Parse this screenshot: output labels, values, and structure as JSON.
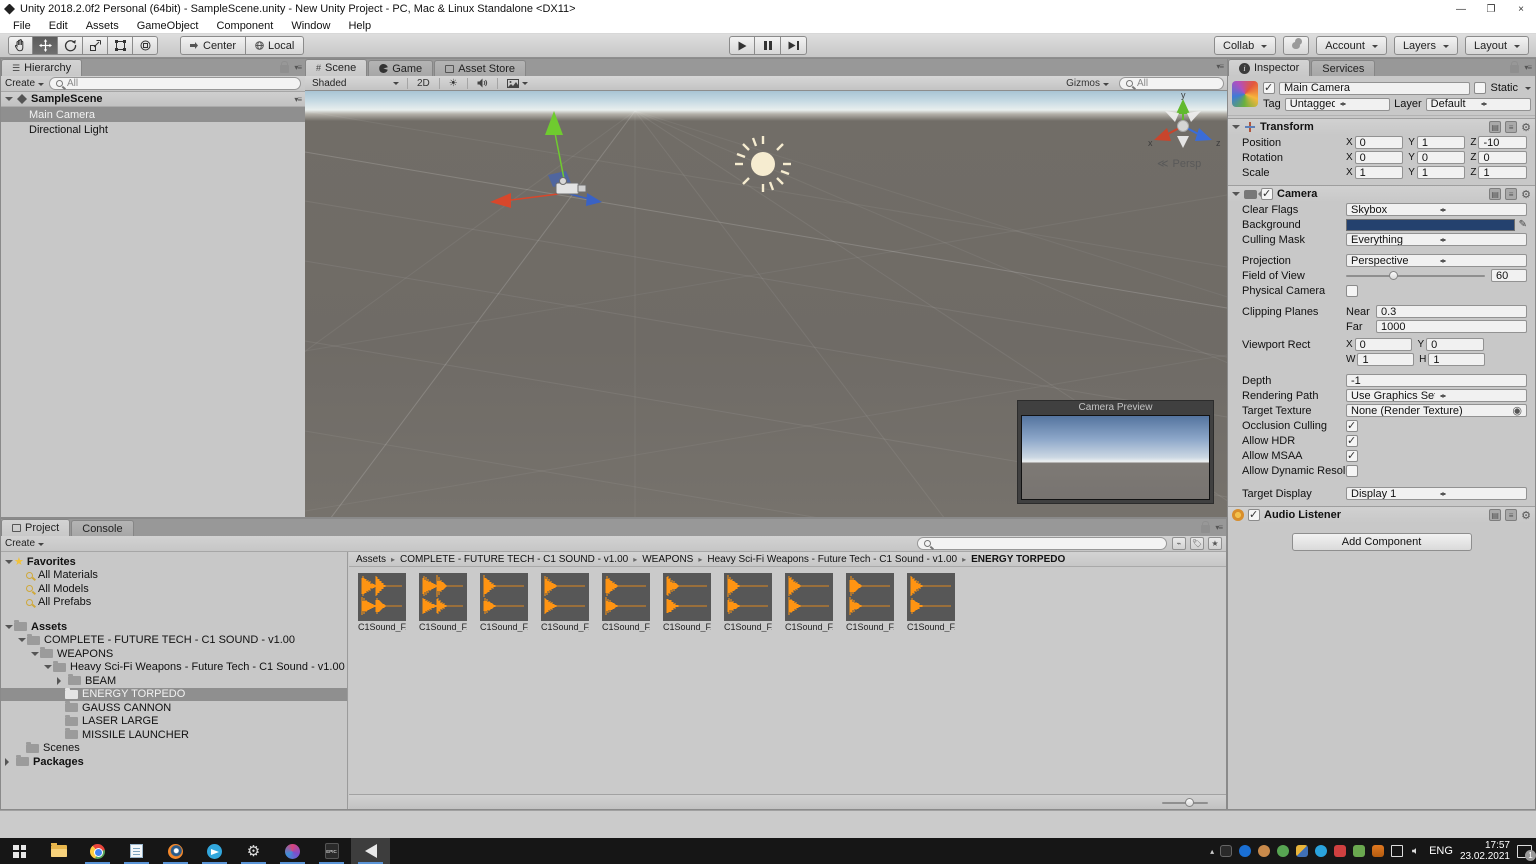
{
  "window": {
    "title": "Unity 2018.2.0f2 Personal (64bit) - SampleScene.unity - New Unity Project - PC, Mac & Linux Standalone <DX11>",
    "minimize": "—",
    "maximize": "❐",
    "close": "×"
  },
  "menubar": {
    "items": [
      "File",
      "Edit",
      "Assets",
      "GameObject",
      "Component",
      "Window",
      "Help"
    ]
  },
  "toolbar": {
    "center": "Center",
    "local": "Local",
    "collab": "Collab",
    "account": "Account",
    "layers": "Layers",
    "layout": "Layout"
  },
  "hierarchy": {
    "tab": "Hierarchy",
    "create": "Create",
    "search": "All",
    "scene_name": "SampleScene",
    "items": [
      {
        "label": "Main Camera",
        "selected": true
      },
      {
        "label": "Directional Light",
        "selected": false
      }
    ]
  },
  "scene": {
    "tabs": [
      {
        "label": "Scene"
      },
      {
        "label": "Game"
      },
      {
        "label": "Asset Store"
      }
    ],
    "shading": "Shaded",
    "mode2d": "2D",
    "gizmos": "Gizmos",
    "search": "All",
    "persp": "Persp",
    "axis_labels": {
      "x": "x",
      "y": "y",
      "z": "z"
    },
    "camera_preview_title": "Camera Preview"
  },
  "inspector": {
    "tabs": [
      {
        "label": "Inspector"
      },
      {
        "label": "Services"
      }
    ],
    "header": {
      "name": "Main Camera",
      "active": true,
      "static_label": "Static",
      "static": false,
      "tag_label": "Tag",
      "tag_value": "Untagged",
      "layer_label": "Layer",
      "layer_value": "Default"
    },
    "transform": {
      "title": "Transform",
      "axis": [
        "X",
        "Y",
        "Z"
      ],
      "rows": [
        {
          "label": "Position",
          "values": [
            "0",
            "1",
            "-10"
          ]
        },
        {
          "label": "Rotation",
          "values": [
            "0",
            "0",
            "0"
          ]
        },
        {
          "label": "Scale",
          "values": [
            "1",
            "1",
            "1"
          ]
        }
      ]
    },
    "camera": {
      "title": "Camera",
      "enabled": true,
      "rows": {
        "clear_flags": {
          "label": "Clear Flags",
          "value": "Skybox"
        },
        "background": {
          "label": "Background",
          "color": "#24416e"
        },
        "culling_mask": {
          "label": "Culling Mask",
          "value": "Everything"
        },
        "projection": {
          "label": "Projection",
          "value": "Perspective"
        },
        "fov": {
          "label": "Field of View",
          "value": "60"
        },
        "physical": {
          "label": "Physical Camera",
          "checked": false
        },
        "clipping": {
          "label": "Clipping Planes",
          "near_label": "Near",
          "near": "0.3",
          "far_label": "Far",
          "far": "1000"
        },
        "viewport": {
          "label": "Viewport Rect",
          "x_label": "X",
          "x": "0",
          "y_label": "Y",
          "y": "0",
          "w_label": "W",
          "w": "1",
          "h_label": "H",
          "h": "1"
        },
        "depth": {
          "label": "Depth",
          "value": "-1"
        },
        "rendering_path": {
          "label": "Rendering Path",
          "value": "Use Graphics Settings"
        },
        "target_texture": {
          "label": "Target Texture",
          "value": "None (Render Texture)"
        },
        "occlusion": {
          "label": "Occlusion Culling",
          "checked": true
        },
        "hdr": {
          "label": "Allow HDR",
          "checked": true
        },
        "msaa": {
          "label": "Allow MSAA",
          "checked": true
        },
        "dynres": {
          "label": "Allow Dynamic Resoluti",
          "checked": false
        },
        "target_display": {
          "label": "Target Display",
          "value": "Display 1"
        }
      }
    },
    "audio_listener": {
      "title": "Audio Listener",
      "enabled": true
    },
    "add_component": "Add Component"
  },
  "project": {
    "tabs": [
      {
        "label": "Project"
      },
      {
        "label": "Console"
      }
    ],
    "create": "Create",
    "favorites": {
      "label": "Favorites",
      "items": [
        "All Materials",
        "All Models",
        "All Prefabs"
      ]
    },
    "tree": [
      {
        "label": "Assets",
        "indent": 0,
        "bold": true,
        "arrow": "open"
      },
      {
        "label": "COMPLETE - FUTURE TECH - C1 SOUND - v1.00",
        "indent": 1,
        "arrow": "open"
      },
      {
        "label": "WEAPONS",
        "indent": 2,
        "arrow": "open"
      },
      {
        "label": "Heavy Sci-Fi Weapons - Future Tech - C1 Sound - v1.00",
        "indent": 3,
        "arrow": "open"
      },
      {
        "label": "BEAM",
        "indent": 4,
        "arrow": "closed"
      },
      {
        "label": "ENERGY TORPEDO",
        "indent": 4,
        "selected": true
      },
      {
        "label": "GAUSS CANNON",
        "indent": 4
      },
      {
        "label": "LASER LARGE",
        "indent": 4
      },
      {
        "label": "MISSILE LAUNCHER",
        "indent": 4
      },
      {
        "label": "Scenes",
        "indent": 1
      },
      {
        "label": "Packages",
        "indent": 0,
        "bold": true,
        "arrow": "closed"
      }
    ],
    "breadcrumb": [
      "Assets",
      "COMPLETE - FUTURE TECH - C1 SOUND - v1.00",
      "WEAPONS",
      "Heavy Sci-Fi Weapons - Future Tech - C1 Sound - v1.00",
      "ENERGY TORPEDO"
    ],
    "files": [
      "C1Sound_F...",
      "C1Sound_F...",
      "C1Sound_F...",
      "C1Sound_F...",
      "C1Sound_F...",
      "C1Sound_F...",
      "C1Sound_F...",
      "C1Sound_F...",
      "C1Sound_F...",
      "C1Sound_F..."
    ],
    "waveform_color": "#ff9412"
  },
  "taskbar": {
    "lang": "ENG",
    "time": "17:57",
    "date": "23.02.2021",
    "badge": "1",
    "apps": [
      {
        "name": "start",
        "running": false
      },
      {
        "name": "file-explorer",
        "running": false
      },
      {
        "name": "chrome",
        "running": true
      },
      {
        "name": "notepad",
        "running": true
      },
      {
        "name": "blender",
        "running": true
      },
      {
        "name": "telegram",
        "running": true
      },
      {
        "name": "settings",
        "running": true
      },
      {
        "name": "paint3d",
        "running": true
      },
      {
        "name": "epic-games",
        "running": true
      },
      {
        "name": "unity",
        "running": true,
        "active": true
      }
    ],
    "tray": [
      "epic-games-tray-icon",
      "bluetooth-icon",
      "tray-icon-1",
      "tray-icon-2",
      "defender-icon",
      "telegram-tray-icon",
      "tray-icon-3",
      "messenger-tray-icon",
      "audio-mixer-icon",
      "display-icon",
      "volume-icon"
    ]
  }
}
